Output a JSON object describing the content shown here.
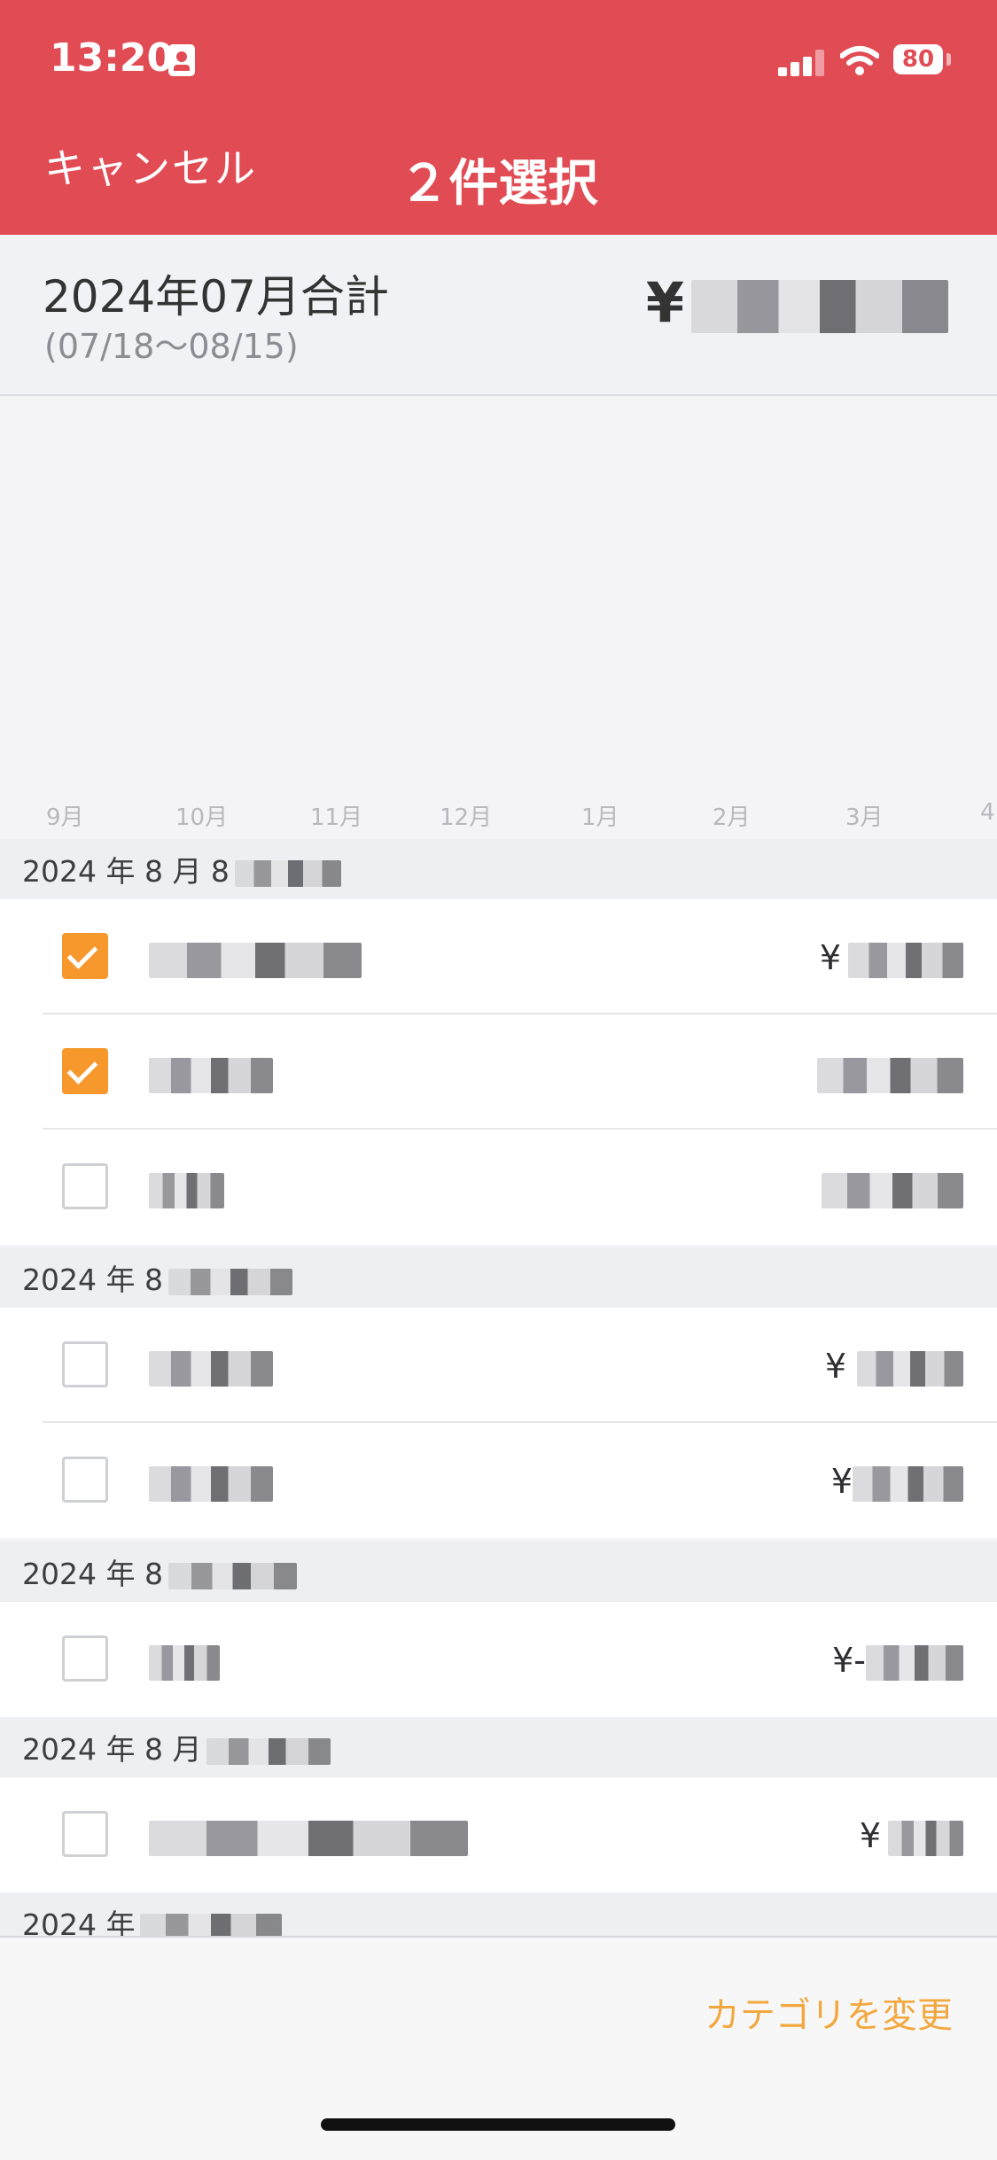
{
  "status_bar": {
    "time": "13:20",
    "battery": "80"
  },
  "header": {
    "cancel_label": "キャンセル",
    "title": "２件選択"
  },
  "summary": {
    "label": "2024年07月合計",
    "range": "(07/18～08/15)",
    "amount": "¥"
  },
  "chart": {
    "months": [
      "9月",
      "10月",
      "11月",
      "12月",
      "1月",
      "2月",
      "3月",
      "4"
    ]
  },
  "sections": [
    {
      "title": "2024 年 8 月 8"
    },
    {
      "title": "2024 年 8"
    },
    {
      "title": "2024 年 8"
    },
    {
      "title": "2024 年 8 月"
    },
    {
      "title": "2024 年"
    }
  ],
  "rows": [
    {
      "checked": true,
      "name": "",
      "amount": "¥"
    },
    {
      "checked": true,
      "name": "",
      "amount": ""
    },
    {
      "checked": false,
      "name": "",
      "amount": ""
    },
    {
      "checked": false,
      "name": "",
      "amount": "¥"
    },
    {
      "checked": false,
      "name": "",
      "amount": "¥"
    },
    {
      "checked": false,
      "name": "",
      "amount": "¥-"
    },
    {
      "checked": false,
      "name": "",
      "amount": "¥"
    }
  ],
  "footer": {
    "change_category_label": "カテゴリを変更"
  },
  "colors": {
    "header": "#e14b54",
    "checkbox_checked": "#f7982d",
    "action_text": "#f3a83f"
  }
}
